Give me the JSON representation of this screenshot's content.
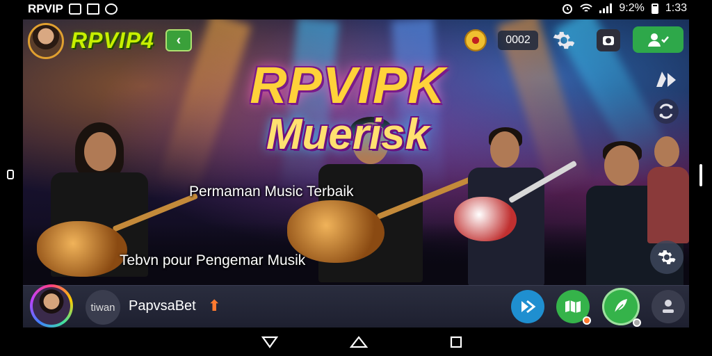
{
  "status_bar": {
    "app_label": "RPVIP",
    "battery": "9:2%",
    "time": "1:33"
  },
  "header": {
    "brand": "RPVIP4",
    "brand_badge": "‹",
    "counter": "0002"
  },
  "banner": {
    "title_line1": "RPVIPK",
    "title_line2": "Muerisk",
    "subtitle1": "Permaman Music Terbaik",
    "subtitle2": "Tebvn pour Pengemar Musik"
  },
  "bottom_bar": {
    "small_avatar_label": "tiwan",
    "player_name": "PapvsaBet",
    "arrow": "⬆"
  },
  "colors": {
    "brand": "#c8f000",
    "add_friend": "#2ea84a",
    "green_btn": "#35b34a",
    "blue_btn": "#1f8fd0"
  }
}
